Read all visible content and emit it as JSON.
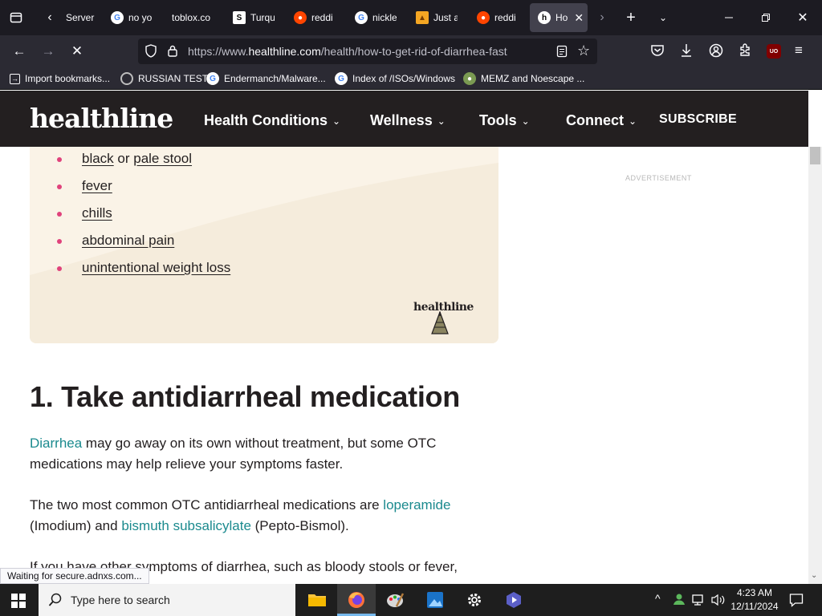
{
  "browser": {
    "tabs": [
      {
        "title": "Server",
        "favicon": "globe-icon"
      },
      {
        "title": "no yo",
        "favicon": "google-icon"
      },
      {
        "title": "toblox.co",
        "favicon": "none"
      },
      {
        "title": "Turqu",
        "favicon": "s-icon"
      },
      {
        "title": "reddi",
        "favicon": "reddit-icon"
      },
      {
        "title": "nickle",
        "favicon": "google-icon"
      },
      {
        "title": "Just a",
        "favicon": "cloudflare-icon"
      },
      {
        "title": "reddi",
        "favicon": "reddit-icon"
      },
      {
        "title": "Ho",
        "favicon": "healthline-icon",
        "active": true
      }
    ],
    "url_prefix": "https://www.",
    "url_domain": "healthline.com",
    "url_path": "/health/how-to-get-rid-of-diarrhea-fast",
    "bookmarks": [
      {
        "label": "Import bookmarks...",
        "icon": "import-icon"
      },
      {
        "label": "RUSSIAN TEST",
        "icon": "github-icon"
      },
      {
        "label": "Endermanch/Malware...",
        "icon": "google-icon"
      },
      {
        "label": "Index of /ISOs/Windows",
        "icon": "google-icon"
      },
      {
        "label": "MEMZ and Noescape ...",
        "icon": "site-icon"
      }
    ],
    "status_text": "Waiting for secure.adnxs.com..."
  },
  "site": {
    "logo": "healthline",
    "nav": [
      "Health Conditions",
      "Wellness",
      "Tools",
      "Connect"
    ],
    "subscribe": "SUBSCRIBE",
    "ad_label": "ADVERTISEMENT",
    "card_logo": "healthline"
  },
  "article": {
    "symptoms": {
      "first_a": "black",
      "first_or": " or ",
      "first_b": "pale stool",
      "items": [
        "fever",
        "chills",
        "abdominal pain",
        "unintentional weight loss"
      ]
    },
    "heading": "1. Take antidiarrheal medication",
    "p1_link": "Diarrhea",
    "p1_line1": " may go away on its own without treatment, but some OTC",
    "p1_line2": "medications may help relieve your symptoms faster.",
    "p2_line1": "The two most common OTC antidiarrheal medications are ",
    "p2_link1": "loperamide",
    "p2_l2a": "(Imodium) and ",
    "p2_link2": "bismuth subsalicylate",
    "p2_l2b": " (Pepto-Bismol).",
    "p3_line1": "If you have other symptoms of diarrhea, such as bloody stools or fever,"
  },
  "taskbar": {
    "search_placeholder": "Type here to search",
    "time": "4:23 AM",
    "date": "12/11/2024"
  },
  "colors": {
    "header_bg": "#231f20",
    "card_bg": "#faf3e7",
    "bullet": "#e0427c",
    "link": "#1b8a8e"
  }
}
